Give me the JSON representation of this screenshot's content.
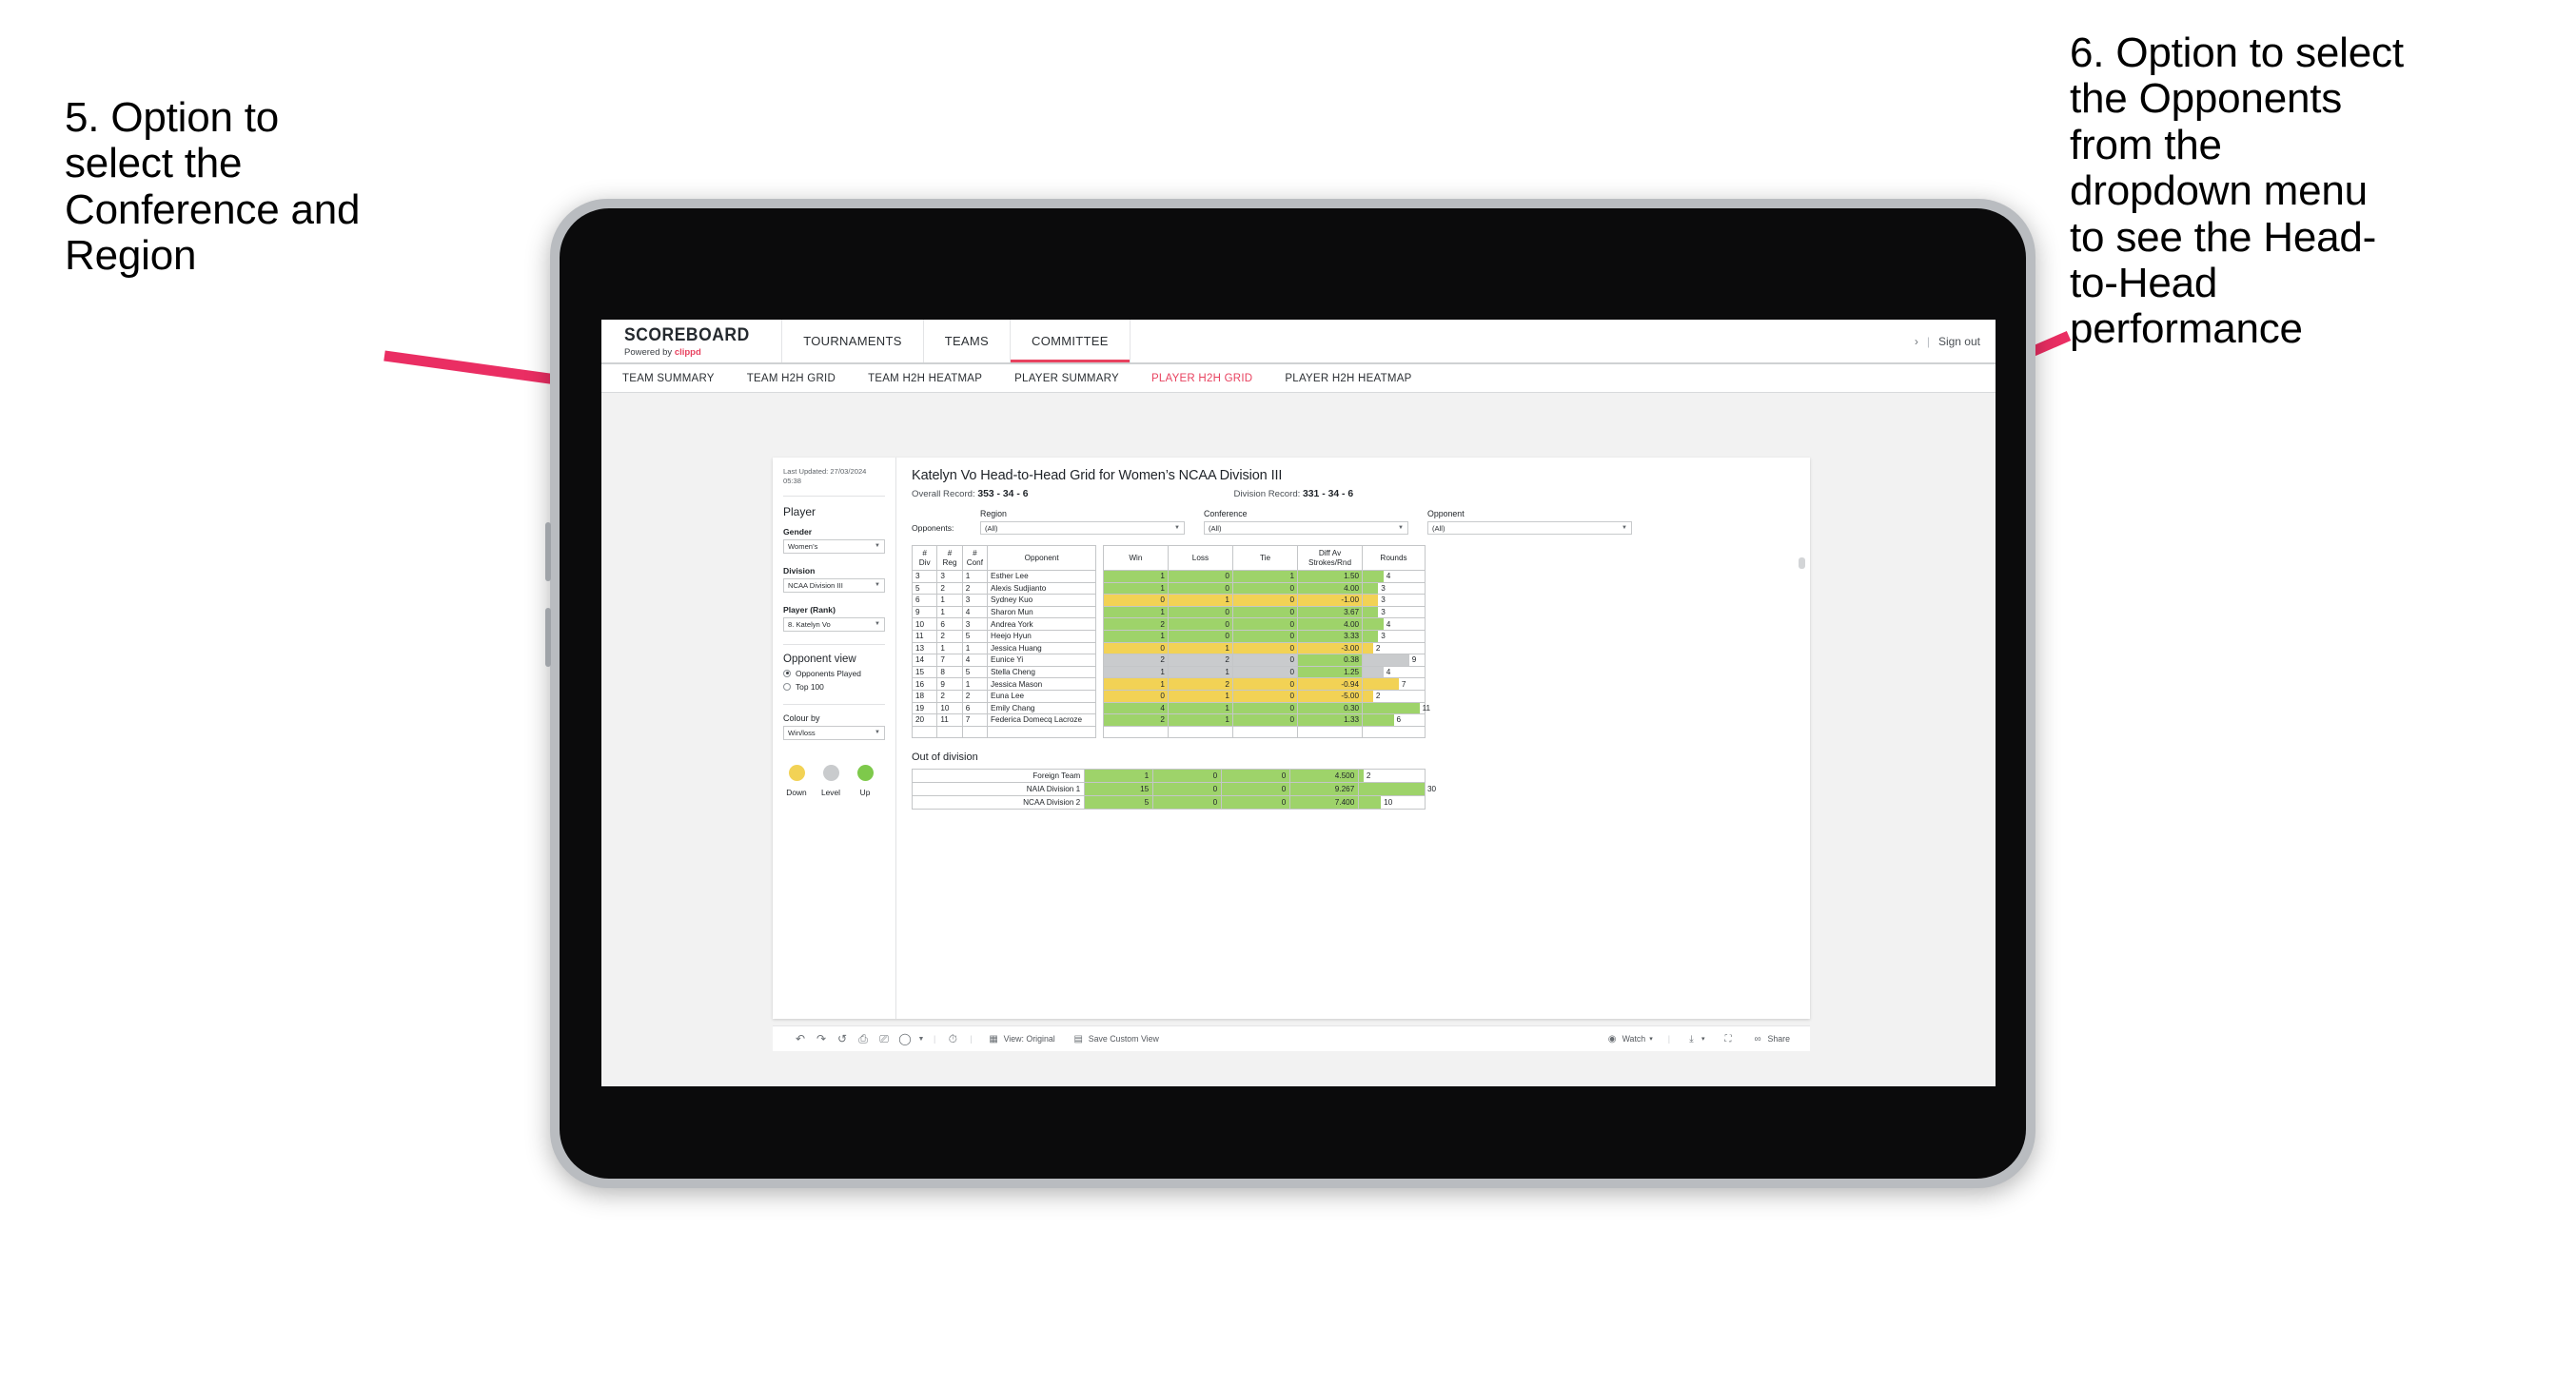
{
  "annotations": {
    "left": "5. Option to\nselect the\nConference and\nRegion",
    "right": "6. Option to select\nthe Opponents\nfrom the\ndropdown menu\nto see the Head-\nto-Head\nperformance"
  },
  "colors": {
    "accent": "#e8425f",
    "up": "#9ed36a",
    "down": "#f2d255",
    "level": "#c9cbcd"
  },
  "app": {
    "brand": {
      "title": "SCOREBOARD",
      "powered_prefix": "Powered by ",
      "powered_brand": "clippd"
    },
    "topnav": [
      {
        "label": "TOURNAMENTS",
        "active": false
      },
      {
        "label": "TEAMS",
        "active": false
      },
      {
        "label": "COMMITTEE",
        "active": true
      }
    ],
    "topbar_right": {
      "chevron": "›",
      "separator": "|",
      "sign_out": "Sign out"
    },
    "subnav": [
      {
        "label": "TEAM SUMMARY",
        "active": false
      },
      {
        "label": "TEAM H2H GRID",
        "active": false
      },
      {
        "label": "TEAM H2H HEATMAP",
        "active": false
      },
      {
        "label": "PLAYER SUMMARY",
        "active": false
      },
      {
        "label": "PLAYER H2H GRID",
        "active": true
      },
      {
        "label": "PLAYER H2H HEATMAP",
        "active": false
      }
    ]
  },
  "sidebar": {
    "last_updated": "Last Updated: 27/03/2024 05:38",
    "player_heading": "Player",
    "fields": [
      {
        "label": "Gender",
        "value": "Women’s"
      },
      {
        "label": "Division",
        "value": "NCAA Division III"
      },
      {
        "label": "Player (Rank)",
        "value": "8. Katelyn Vo"
      }
    ],
    "opponent_view": {
      "heading": "Opponent view",
      "options": [
        {
          "label": "Opponents Played",
          "selected": true
        },
        {
          "label": "Top 100",
          "selected": false
        }
      ]
    },
    "colour_by": {
      "label": "Colour by",
      "value": "Win/loss"
    },
    "legend": [
      {
        "label": "Down",
        "color": "#f2d255"
      },
      {
        "label": "Level",
        "color": "#c9cbcd"
      },
      {
        "label": "Up",
        "color": "#9ed36a"
      }
    ]
  },
  "main": {
    "title": "Katelyn Vo Head-to-Head Grid for Women’s NCAA Division III",
    "overall_record_label": "Overall Record:",
    "overall_record_value": "353 - 34 - 6",
    "division_record_label": "Division Record:",
    "division_record_value": "331 -  34 - 6",
    "filters_label": "Opponents:",
    "filters": [
      {
        "label": "Region",
        "value": "(All)"
      },
      {
        "label": "Conference",
        "value": "(All)"
      },
      {
        "label": "Opponent",
        "value": "(All)"
      }
    ],
    "table": {
      "headers": [
        "#\nDiv",
        "#\nReg",
        "#\nConf",
        "Opponent",
        "Win",
        "Loss",
        "Tie",
        "Diff Av\nStrokes/Rnd",
        "Rounds"
      ],
      "rows": [
        {
          "div": "3",
          "reg": "3",
          "conf": "1",
          "opponent": "Esther Lee",
          "win": "1",
          "loss": "0",
          "tie": "1",
          "diff": "1.50",
          "rounds": "4",
          "state": "up"
        },
        {
          "div": "5",
          "reg": "2",
          "conf": "2",
          "opponent": "Alexis Sudjianto",
          "win": "1",
          "loss": "0",
          "tie": "0",
          "diff": "4.00",
          "rounds": "3",
          "state": "up"
        },
        {
          "div": "6",
          "reg": "1",
          "conf": "3",
          "opponent": "Sydney Kuo",
          "win": "0",
          "loss": "1",
          "tie": "0",
          "diff": "-1.00",
          "rounds": "3",
          "state": "down"
        },
        {
          "div": "9",
          "reg": "1",
          "conf": "4",
          "opponent": "Sharon Mun",
          "win": "1",
          "loss": "0",
          "tie": "0",
          "diff": "3.67",
          "rounds": "3",
          "state": "up"
        },
        {
          "div": "10",
          "reg": "6",
          "conf": "3",
          "opponent": "Andrea York",
          "win": "2",
          "loss": "0",
          "tie": "0",
          "diff": "4.00",
          "rounds": "4",
          "state": "up"
        },
        {
          "div": "11",
          "reg": "2",
          "conf": "5",
          "opponent": "Heejo Hyun",
          "win": "1",
          "loss": "0",
          "tie": "0",
          "diff": "3.33",
          "rounds": "3",
          "state": "up"
        },
        {
          "div": "13",
          "reg": "1",
          "conf": "1",
          "opponent": "Jessica Huang",
          "win": "0",
          "loss": "1",
          "tie": "0",
          "diff": "-3.00",
          "rounds": "2",
          "state": "down"
        },
        {
          "div": "14",
          "reg": "7",
          "conf": "4",
          "opponent": "Eunice Yi",
          "win": "2",
          "loss": "2",
          "tie": "0",
          "diff": "0.38",
          "rounds": "9",
          "state": "level",
          "diff_state": "up"
        },
        {
          "div": "15",
          "reg": "8",
          "conf": "5",
          "opponent": "Stella Cheng",
          "win": "1",
          "loss": "1",
          "tie": "0",
          "diff": "1.25",
          "rounds": "4",
          "state": "level",
          "diff_state": "up"
        },
        {
          "div": "16",
          "reg": "9",
          "conf": "1",
          "opponent": "Jessica Mason",
          "win": "1",
          "loss": "2",
          "tie": "0",
          "diff": "-0.94",
          "rounds": "7",
          "state": "down"
        },
        {
          "div": "18",
          "reg": "2",
          "conf": "2",
          "opponent": "Euna Lee",
          "win": "0",
          "loss": "1",
          "tie": "0",
          "diff": "-5.00",
          "rounds": "2",
          "state": "down"
        },
        {
          "div": "19",
          "reg": "10",
          "conf": "6",
          "opponent": "Emily Chang",
          "win": "4",
          "loss": "1",
          "tie": "0",
          "diff": "0.30",
          "rounds": "11",
          "state": "up"
        },
        {
          "div": "20",
          "reg": "11",
          "conf": "7",
          "opponent": "Federica Domecq Lacroze",
          "win": "2",
          "loss": "1",
          "tie": "0",
          "diff": "1.33",
          "rounds": "6",
          "state": "up"
        }
      ]
    },
    "out_of_division": {
      "heading": "Out of division",
      "rows": [
        {
          "name": "Foreign Team",
          "win": "1",
          "loss": "0",
          "tie": "0",
          "diff": "4.500",
          "rounds": "2",
          "state": "up"
        },
        {
          "name": "NAIA Division 1",
          "win": "15",
          "loss": "0",
          "tie": "0",
          "diff": "9.267",
          "rounds": "30",
          "state": "up"
        },
        {
          "name": "NCAA Division 2",
          "win": "5",
          "loss": "0",
          "tie": "0",
          "diff": "7.400",
          "rounds": "10",
          "state": "up"
        }
      ]
    }
  },
  "toolbar": {
    "view_label": "View: Original",
    "save_view_label": "Save Custom View",
    "watch_label": "Watch",
    "share_label": "Share",
    "separator": "|",
    "caret": "▾"
  },
  "chart_data": {
    "type": "table",
    "title": "Katelyn Vo Head-to-Head Grid for Women’s NCAA Division III",
    "columns": [
      "# Div",
      "# Reg",
      "# Conf",
      "Opponent",
      "Win",
      "Loss",
      "Tie",
      "Diff Av Strokes/Rnd",
      "Rounds"
    ],
    "rows": [
      [
        "3",
        "3",
        "1",
        "Esther Lee",
        1,
        0,
        1,
        1.5,
        4
      ],
      [
        "5",
        "2",
        "2",
        "Alexis Sudjianto",
        1,
        0,
        0,
        4.0,
        3
      ],
      [
        "6",
        "1",
        "3",
        "Sydney Kuo",
        0,
        1,
        0,
        -1.0,
        3
      ],
      [
        "9",
        "1",
        "4",
        "Sharon Mun",
        1,
        0,
        0,
        3.67,
        3
      ],
      [
        "10",
        "6",
        "3",
        "Andrea York",
        2,
        0,
        0,
        4.0,
        4
      ],
      [
        "11",
        "2",
        "5",
        "Heejo Hyun",
        1,
        0,
        0,
        3.33,
        3
      ],
      [
        "13",
        "1",
        "1",
        "Jessica Huang",
        0,
        1,
        0,
        -3.0,
        2
      ],
      [
        "14",
        "7",
        "4",
        "Eunice Yi",
        2,
        2,
        0,
        0.38,
        9
      ],
      [
        "15",
        "8",
        "5",
        "Stella Cheng",
        1,
        1,
        0,
        1.25,
        4
      ],
      [
        "16",
        "9",
        "1",
        "Jessica Mason",
        1,
        2,
        0,
        -0.94,
        7
      ],
      [
        "18",
        "2",
        "2",
        "Euna Lee",
        0,
        1,
        0,
        -5.0,
        2
      ],
      [
        "19",
        "10",
        "6",
        "Emily Chang",
        4,
        1,
        0,
        0.3,
        11
      ],
      [
        "20",
        "11",
        "7",
        "Federica Domecq Lacroze",
        2,
        1,
        0,
        1.33,
        6
      ]
    ],
    "out_of_division_rows": [
      [
        "Foreign Team",
        1,
        0,
        0,
        4.5,
        2
      ],
      [
        "NAIA Division 1",
        15,
        0,
        0,
        9.267,
        30
      ],
      [
        "NCAA Division 2",
        5,
        0,
        0,
        7.4,
        10
      ]
    ],
    "legend": [
      "Down",
      "Level",
      "Up"
    ],
    "rounds_bar_max": 30
  }
}
